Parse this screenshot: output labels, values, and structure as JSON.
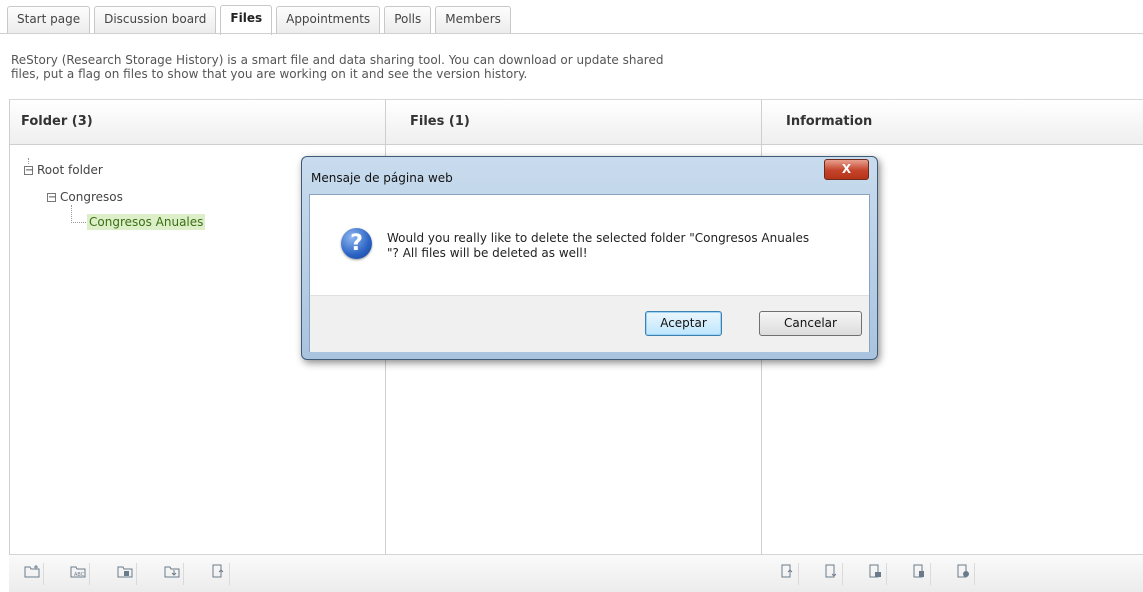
{
  "tabs": [
    "Start page",
    "Discussion board",
    "Files",
    "Appointments",
    "Polls",
    "Members"
  ],
  "active_tab": "Files",
  "intro": {
    "line1": "ReStory (Research Storage History) is a smart file and data sharing tool. You can download or update shared",
    "line2": "files, put a flag on files to show that you are working on it and see the version history."
  },
  "panels": {
    "folder_header": "Folder (3)",
    "files_header": "Files (1)",
    "info_header": "Information"
  },
  "tree": {
    "root": "Root folder",
    "child": "Congresos",
    "grandchild": "Congresos Anuales",
    "toggle_symbol": "−"
  },
  "dialog": {
    "title": "Mensaje de página web",
    "close_label": "X",
    "message_line1": "Would you really like to delete the selected folder \"Congresos Anuales",
    "message_line2": "\"? All files will be deleted as well!",
    "icon_glyph": "?",
    "ok_label": "Aceptar",
    "cancel_label": "Cancelar"
  },
  "icons": {
    "folder_tools": [
      "new-folder-icon",
      "rename-folder-icon",
      "delete-folder-icon",
      "download-folder-icon",
      "upload-file-icon"
    ],
    "info_tools": [
      "upload-version-icon",
      "download-file-icon",
      "lock-file-icon",
      "delete-file-icon",
      "history-icon"
    ]
  },
  "colors": {
    "selected_bg": "#dcefc9",
    "selected_text": "#3c6f14",
    "dialog_frame": "#a9c3df",
    "close_button": "#c4432a"
  }
}
